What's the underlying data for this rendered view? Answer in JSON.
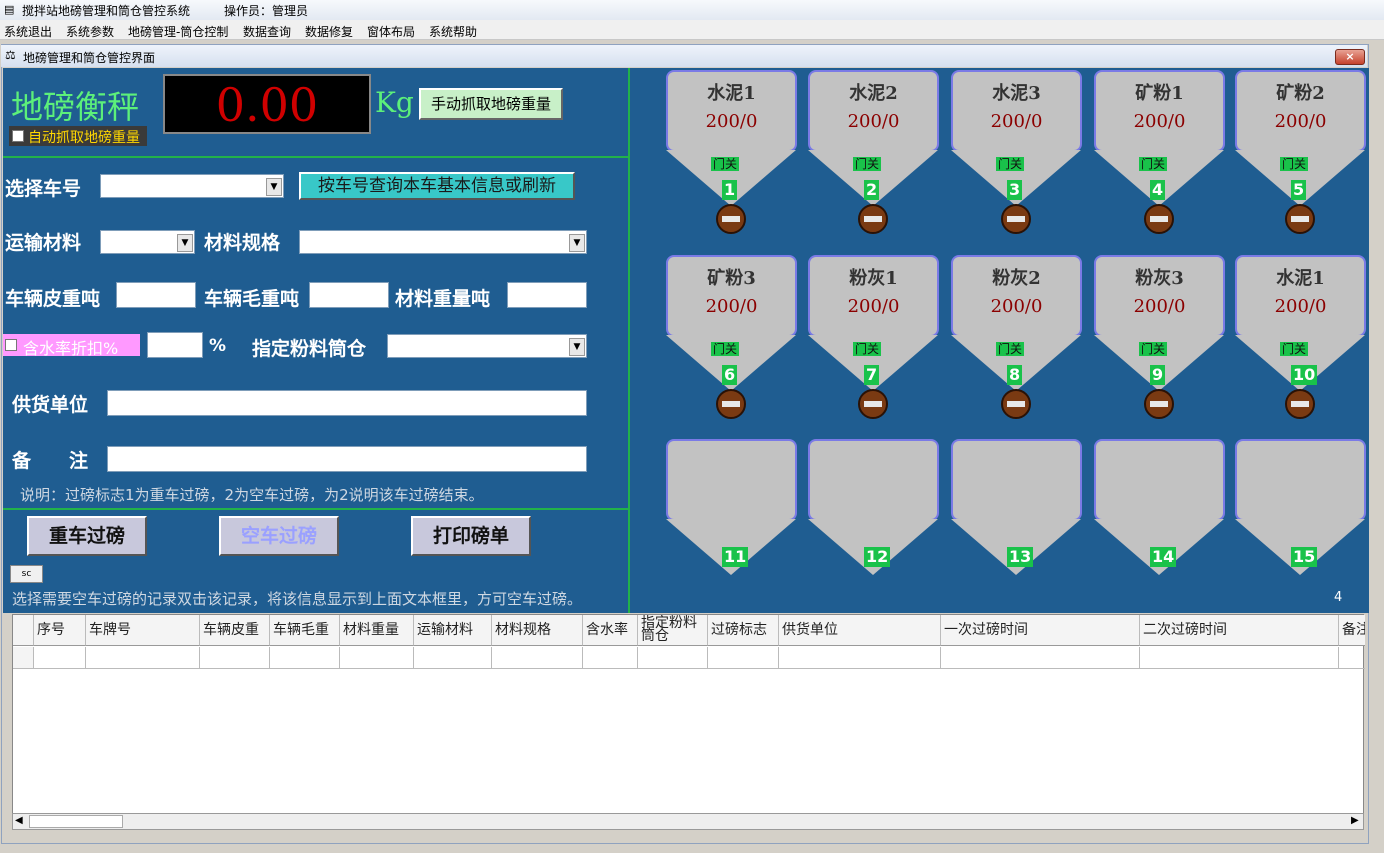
{
  "app": {
    "title": "搅拌站地磅管理和筒仓管控系统",
    "operator": "操作员：管理员"
  },
  "menu": [
    "系统退出",
    "系统参数",
    "地磅管理-筒仓控制",
    "数据查询",
    "数据修复",
    "窗体布局",
    "系统帮助"
  ],
  "child_window": {
    "title": "地磅管理和筒仓管控界面",
    "close": "×"
  },
  "scale": {
    "label": "地磅衡秤",
    "weight": "0.00",
    "unit": "Kg",
    "manual_btn": "手动抓取地磅重量",
    "auto_label": "自动抓取地磅重量"
  },
  "form": {
    "select_truck": "选择车号",
    "query_btn": "按车号查询本车基本信息或刷新",
    "transport_material": "运输材料",
    "material_spec": "材料规格",
    "tare_weight": "车辆皮重吨",
    "gross_weight": "车辆毛重吨",
    "material_weight": "材料重量吨",
    "moisture_discount": "含水率折扣%",
    "percent": "%",
    "assign_silo": "指定粉料筒仓",
    "supplier": "供货单位",
    "remark": "备　　注",
    "note": "说明：过磅标志1为重车过磅，2为空车过磅，为2说明该车过磅结束。"
  },
  "buttons": {
    "heavy": "重车过磅",
    "empty": "空车过磅",
    "print": "打印磅单",
    "sc": "sc"
  },
  "hint": "选择需要空车过磅的记录双击该记录，将该信息显示到上面文本框里，方可空车过磅。",
  "counter": "4",
  "silos": [
    {
      "name": "水泥1",
      "value": "200/0",
      "gate": "门关",
      "num": "1"
    },
    {
      "name": "水泥2",
      "value": "200/0",
      "gate": "门关",
      "num": "2"
    },
    {
      "name": "水泥3",
      "value": "200/0",
      "gate": "门关",
      "num": "3"
    },
    {
      "name": "矿粉1",
      "value": "200/0",
      "gate": "门关",
      "num": "4"
    },
    {
      "name": "矿粉2",
      "value": "200/0",
      "gate": "门关",
      "num": "5"
    },
    {
      "name": "矿粉3",
      "value": "200/0",
      "gate": "门关",
      "num": "6"
    },
    {
      "name": "粉灰1",
      "value": "200/0",
      "gate": "门关",
      "num": "7"
    },
    {
      "name": "粉灰2",
      "value": "200/0",
      "gate": "门关",
      "num": "8"
    },
    {
      "name": "粉灰3",
      "value": "200/0",
      "gate": "门关",
      "num": "9"
    },
    {
      "name": "水泥1",
      "value": "200/0",
      "gate": "门关",
      "num": "10"
    },
    {
      "name": "",
      "value": "",
      "gate": "",
      "num": "11"
    },
    {
      "name": "",
      "value": "",
      "gate": "",
      "num": "12"
    },
    {
      "name": "",
      "value": "",
      "gate": "",
      "num": "13"
    },
    {
      "name": "",
      "value": "",
      "gate": "",
      "num": "14"
    },
    {
      "name": "",
      "value": "",
      "gate": "",
      "num": "15"
    }
  ],
  "table": {
    "columns": [
      "序号",
      "车牌号",
      "车辆皮重",
      "车辆毛重",
      "材料重量",
      "运输材料",
      "材料规格",
      "含水率",
      "指定粉料筒仓",
      "过磅标志",
      "供货单位",
      "一次过磅时间",
      "二次过磅时间",
      "备注"
    ]
  }
}
